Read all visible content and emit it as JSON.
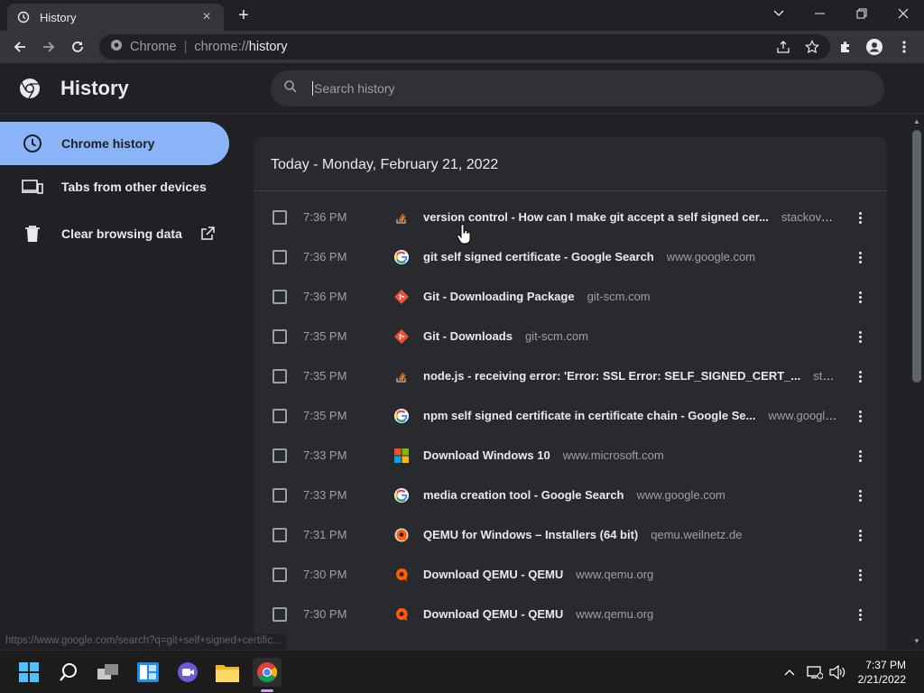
{
  "tab": {
    "title": "History",
    "close_glyph": "×",
    "new_tab_glyph": "+"
  },
  "window_controls": {
    "dropdown": "⌄",
    "minimize": "—",
    "restore": "❐",
    "close": "✕"
  },
  "omnibox": {
    "site_label": "Chrome",
    "separator": "|",
    "scheme": "chrome://",
    "path": "history"
  },
  "header": {
    "title": "History",
    "search_placeholder": "Search history"
  },
  "sidebar": {
    "items": [
      {
        "label": "Chrome history",
        "icon": "clock-icon"
      },
      {
        "label": "Tabs from other devices",
        "icon": "devices-icon"
      },
      {
        "label": "Clear browsing data",
        "icon": "trash-icon",
        "trailing_icon": "open-in-new-icon"
      }
    ]
  },
  "history": {
    "date_heading": "Today - Monday, February 21, 2022",
    "rows": [
      {
        "time": "7:36 PM",
        "title": "version control - How can I make git accept a self signed cer...",
        "domain": "stackoverflo...",
        "favicon": "stackoverflow"
      },
      {
        "time": "7:36 PM",
        "title": "git self signed certificate - Google Search",
        "domain": "www.google.com",
        "favicon": "google"
      },
      {
        "time": "7:36 PM",
        "title": "Git - Downloading Package",
        "domain": "git-scm.com",
        "favicon": "git"
      },
      {
        "time": "7:35 PM",
        "title": "Git - Downloads",
        "domain": "git-scm.com",
        "favicon": "git"
      },
      {
        "time": "7:35 PM",
        "title": "node.js - receiving error: 'Error: SSL Error: SELF_SIGNED_CERT_...",
        "domain": "stackover...",
        "favicon": "stackoverflow"
      },
      {
        "time": "7:35 PM",
        "title": "npm self signed certificate in certificate chain - Google Se...",
        "domain": "www.google.c...",
        "favicon": "google"
      },
      {
        "time": "7:33 PM",
        "title": "Download Windows 10",
        "domain": "www.microsoft.com",
        "favicon": "microsoft"
      },
      {
        "time": "7:33 PM",
        "title": "media creation tool - Google Search",
        "domain": "www.google.com",
        "favicon": "google"
      },
      {
        "time": "7:31 PM",
        "title": "QEMU for Windows – Installers (64 bit)",
        "domain": "qemu.weilnetz.de",
        "favicon": "qemu-weilnetz"
      },
      {
        "time": "7:30 PM",
        "title": "Download QEMU - QEMU",
        "domain": "www.qemu.org",
        "favicon": "qemu"
      },
      {
        "time": "7:30 PM",
        "title": "Download QEMU - QEMU",
        "domain": "www.qemu.org",
        "favicon": "qemu"
      }
    ]
  },
  "status_bar": {
    "url": "https://www.google.com/search?q=git+self+signed+certific..."
  },
  "taskbar": {
    "apps": [
      "windows-start-icon",
      "search-icon",
      "task-view-icon",
      "widgets-icon",
      "teams-chat-icon",
      "file-explorer-icon",
      "chrome-icon"
    ],
    "clock_time": "7:37 PM",
    "clock_date": "2/21/2022",
    "tray_chevron": "^"
  },
  "colors": {
    "accent": "#8ab4f8",
    "background": "#202124",
    "card": "#292a2d"
  }
}
